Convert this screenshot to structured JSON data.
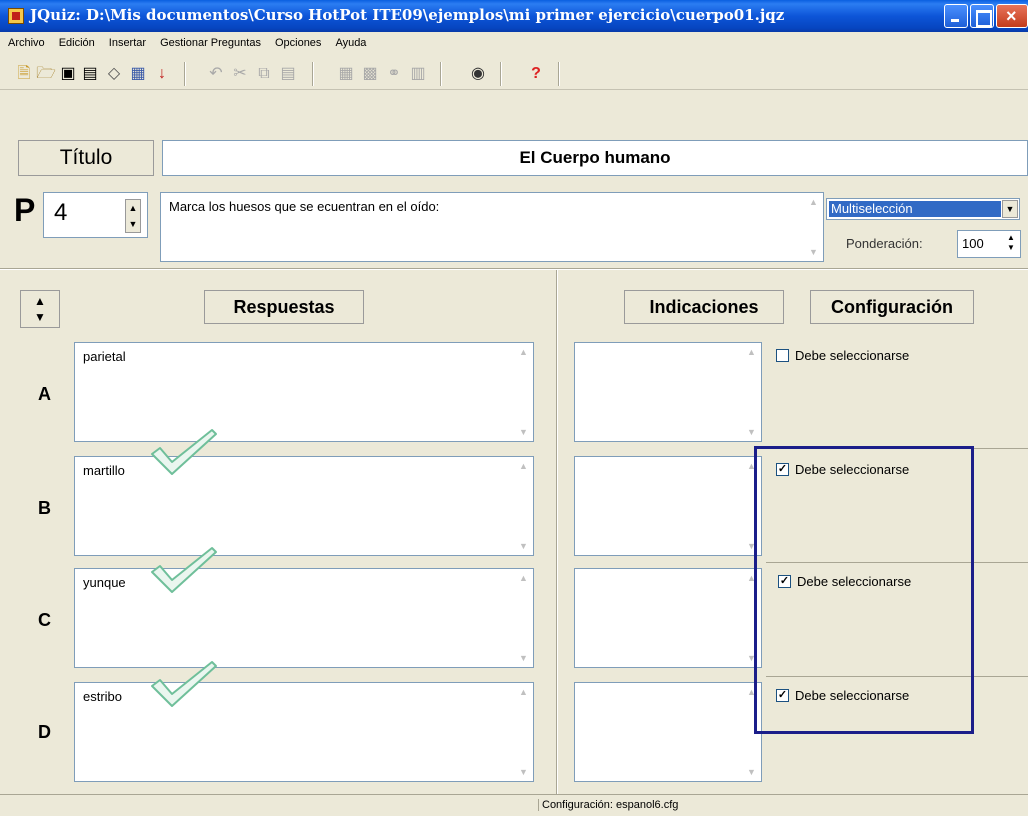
{
  "window": {
    "title": "JQuiz: D:\\Mis documentos\\Curso HotPot ITE09\\ejemplos\\mi primer ejercicio\\cuerpo01.jqz"
  },
  "menu": [
    "Archivo",
    "Edición",
    "Insertar",
    "Gestionar Preguntas",
    "Opciones",
    "Ayuda"
  ],
  "toolbar": {
    "icons": [
      "new-icon",
      "open-icon",
      "save-icon",
      "save-as-icon",
      "eraser-icon",
      "export-icon",
      "download-icon",
      "undo-icon",
      "cut-icon",
      "copy-icon",
      "paste-icon",
      "insert-picture-icon",
      "insert-table-icon",
      "insert-link-icon",
      "insert-media-icon",
      "web-export-icon",
      "help-icon"
    ],
    "help_label": "?"
  },
  "header": {
    "titulo_label": "Título",
    "titulo_value": "El Cuerpo humano",
    "p_label": "P",
    "question_number": "4",
    "question_text": "Marca los huesos que se ecuentran en el oído:",
    "question_type": "Multiselección",
    "ponderacion_label": "Ponderación:",
    "ponderacion_value": "100"
  },
  "panels": {
    "respuestas_label": "Respuestas",
    "indicaciones_label": "Indicaciones",
    "configuracion_label": "Configuración"
  },
  "answers": [
    {
      "letter": "A",
      "text": "parietal",
      "config_label": "Debe seleccionarse",
      "checked": false,
      "correct": false
    },
    {
      "letter": "B",
      "text": "martillo",
      "config_label": "Debe seleccionarse",
      "checked": true,
      "correct": true
    },
    {
      "letter": "C",
      "text": "yunque",
      "config_label": "Debe seleccionarse",
      "checked": true,
      "correct": true
    },
    {
      "letter": "D",
      "text": "estribo",
      "config_label": "Debe seleccionarse",
      "checked": true,
      "correct": true
    }
  ],
  "statusbar": {
    "text": "Configuración: espanol6.cfg"
  },
  "colors": {
    "titlebar": "#0a5fe0",
    "highlight_box": "#1b1e8a",
    "checkmark": "#6fbf9a",
    "selected": "#316ac5"
  }
}
